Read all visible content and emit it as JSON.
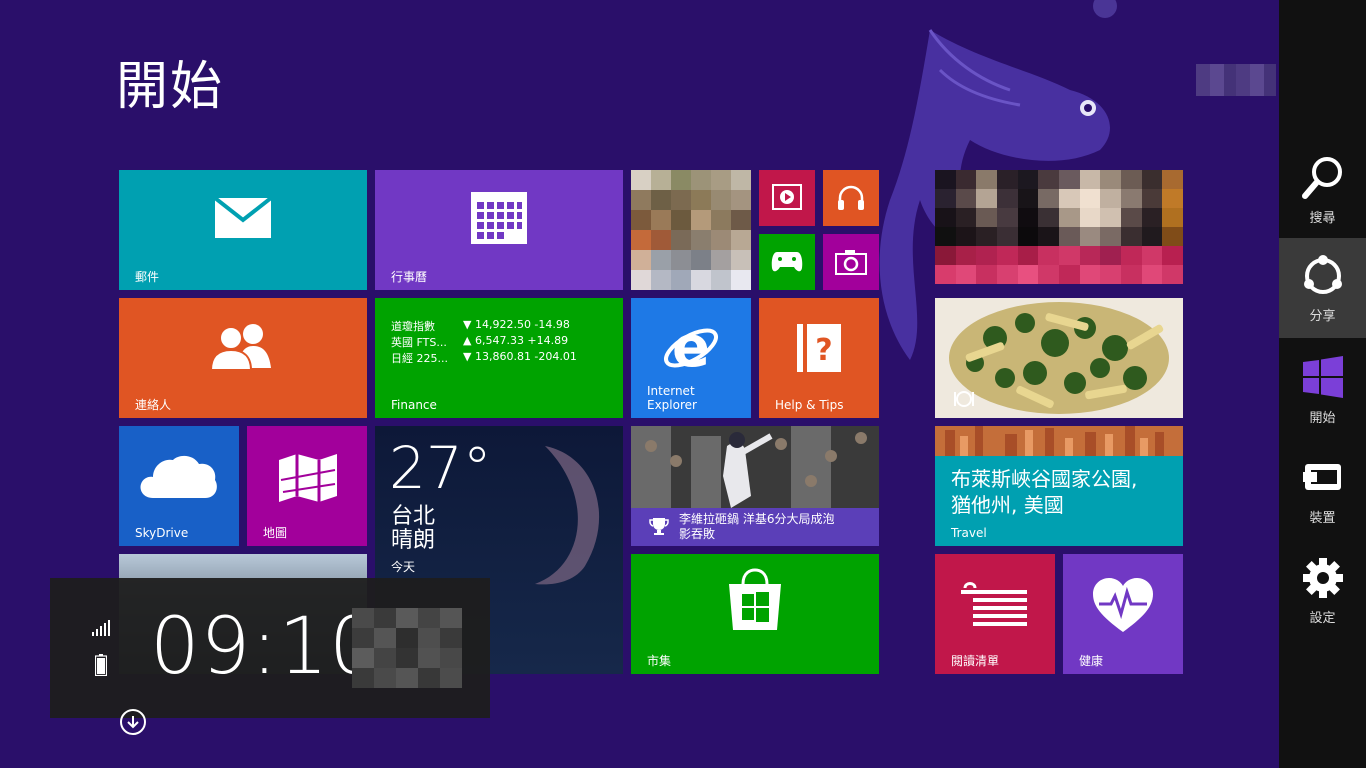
{
  "start": {
    "title": "開始"
  },
  "tiles": {
    "mail": {
      "label": "郵件",
      "color": "#00a0b1"
    },
    "calendar": {
      "label": "行事曆",
      "color": "#7138c4"
    },
    "people": {
      "label": "連絡人",
      "color": "#e05523"
    },
    "finance": {
      "label": "Finance",
      "color": "#00a300",
      "rows": [
        {
          "name": "道瓊指數",
          "value": "▼ 14,922.50 -14.98"
        },
        {
          "name": "英國 FTS...",
          "value": "▲ 6,547.33 +14.89"
        },
        {
          "name": "日經 225...",
          "value": "▼ 13,860.81 -204.01"
        }
      ]
    },
    "ie": {
      "label_line1": "Internet",
      "label_line2": "Explorer",
      "color": "#1e79e6"
    },
    "help": {
      "label": "Help & Tips",
      "color": "#e05523"
    },
    "skydrive": {
      "label": "SkyDrive",
      "color": "#1860c7"
    },
    "maps": {
      "label": "地圖",
      "color": "#a2009b"
    },
    "weather": {
      "temp": "27°",
      "city": "台北",
      "condition": "晴朗",
      "today_label": "今天"
    },
    "sports": {
      "headline_line1": "李維拉砸鍋 洋基6分大局成泡",
      "headline_line2": "影吞敗"
    },
    "store": {
      "label": "市集",
      "color": "#00a300"
    },
    "travel": {
      "title_line1": "布萊斯峽谷國家公園,",
      "title_line2": "猶他州, 美國",
      "label": "Travel",
      "color": "#00a0b1"
    },
    "reading_list": {
      "label": "閱讀清單",
      "color": "#c1174a"
    },
    "health": {
      "label": "健康",
      "color": "#7138c4"
    }
  },
  "charms": {
    "search": "搜尋",
    "share": "分享",
    "start": "開始",
    "devices": "裝置",
    "settings": "設定"
  },
  "clock": {
    "time": "09:10"
  }
}
